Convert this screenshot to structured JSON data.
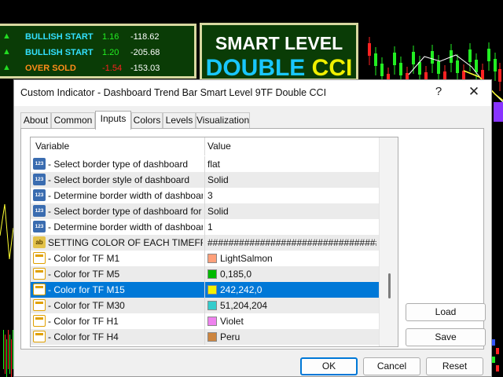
{
  "background": {
    "dashboard_rows": [
      {
        "arrow": "▲",
        "label": "BULLISH START",
        "label_color": "#33e0ff",
        "value1": "1.16",
        "value1_color": "#22ee22",
        "value2": "-118.62"
      },
      {
        "arrow": "▲",
        "label": "BULLISH START",
        "label_color": "#33e0ff",
        "value1": "1.20",
        "value1_color": "#22ee22",
        "value2": "-205.68"
      },
      {
        "arrow": "▲",
        "label": "OVER SOLD",
        "label_color": "#ff8c1a",
        "value1": "-1.54",
        "value1_color": "#ff2020",
        "value2": "-153.03"
      }
    ],
    "banner": {
      "line1": "SMART LEVEL",
      "line2a": "DOUBLE",
      "line2b": "CCI"
    }
  },
  "dialog": {
    "title": "Custom Indicator - Dashboard Trend Bar Smart Level 9TF Double CCI",
    "help_label": "?",
    "close_label": "✕",
    "tabs": [
      {
        "label": "About",
        "active": false
      },
      {
        "label": "Common",
        "active": false
      },
      {
        "label": "Inputs",
        "active": true
      },
      {
        "label": "Colors",
        "active": false
      },
      {
        "label": "Levels",
        "active": false
      },
      {
        "label": "Visualization",
        "active": false
      }
    ],
    "grid": {
      "col_variable": "Variable",
      "col_value": "Value",
      "rows": [
        {
          "icon": "123",
          "type": "num",
          "name": "- Select border type of dashboard",
          "value": "flat"
        },
        {
          "icon": "123",
          "type": "num",
          "name": "- Select border style of dashboard",
          "value": "Solid"
        },
        {
          "icon": "123",
          "type": "num",
          "name": "- Determine border width of dashboard",
          "value": "3"
        },
        {
          "icon": "123",
          "type": "num",
          "name": "- Select border type of dashboard for e...",
          "value": "Solid"
        },
        {
          "icon": "123",
          "type": "num",
          "name": "- Determine border width of dashboard f...",
          "value": "1"
        },
        {
          "icon": "ab",
          "type": "ab",
          "name": "SETTING COLOR OF EACH TIMEFRA...",
          "value": "########################################"
        },
        {
          "icon": "",
          "type": "col",
          "name": "- Color for TF M1",
          "value": "LightSalmon",
          "swatch": "#ffa07a"
        },
        {
          "icon": "",
          "type": "col",
          "name": "- Color for TF M5",
          "value": "0,185,0",
          "swatch": "#00b900"
        },
        {
          "icon": "",
          "type": "col",
          "name": "- Color for TF M15",
          "value": "242,242,0",
          "swatch": "#f2f200",
          "selected": true
        },
        {
          "icon": "",
          "type": "col",
          "name": "- Color for TF M30",
          "value": "51,204,204",
          "swatch": "#33cccc"
        },
        {
          "icon": "",
          "type": "col",
          "name": "- Color for TF H1",
          "value": "Violet",
          "swatch": "#ee82ee"
        },
        {
          "icon": "",
          "type": "col",
          "name": "- Color for TF H4",
          "value": "Peru",
          "swatch": "#cd853f"
        }
      ]
    },
    "buttons": {
      "load": "Load",
      "save": "Save",
      "ok": "OK",
      "cancel": "Cancel",
      "reset": "Reset"
    }
  }
}
